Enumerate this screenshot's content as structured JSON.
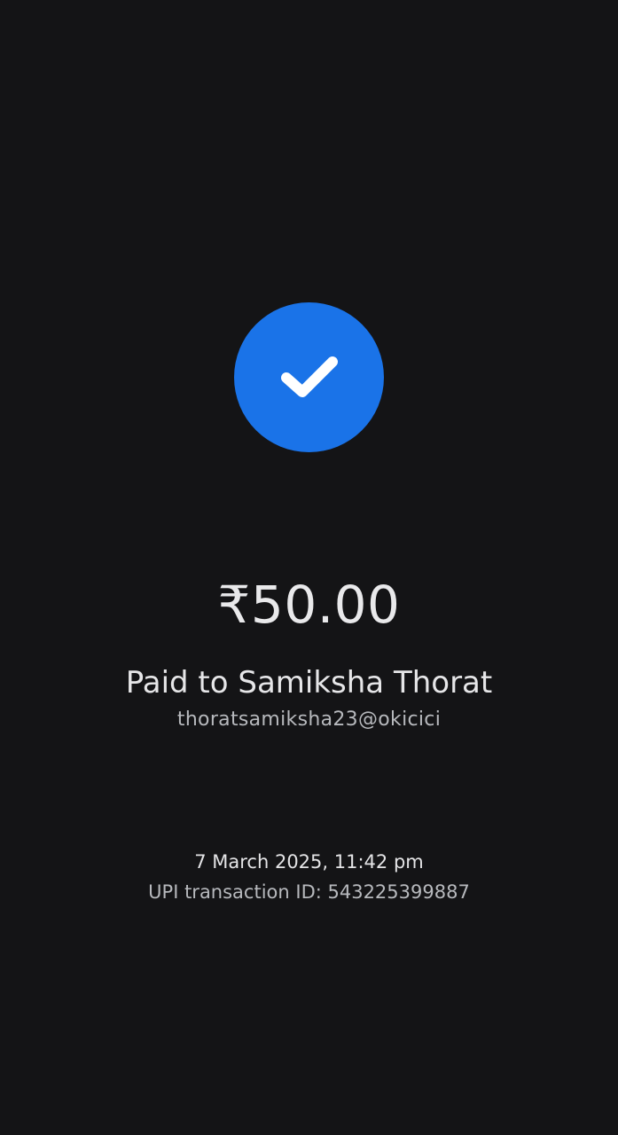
{
  "payment": {
    "amount": "₹50.00",
    "payee_line": "Paid to Samiksha Thorat",
    "payee_upi": "thoratsamiksha23@okicici",
    "datetime": "7 March 2025, 11:42 pm",
    "transaction_id_line": "UPI transaction ID: 543225399887"
  },
  "icons": {
    "success": "check-icon"
  },
  "colors": {
    "background": "#141416",
    "accent": "#1a73e8"
  }
}
